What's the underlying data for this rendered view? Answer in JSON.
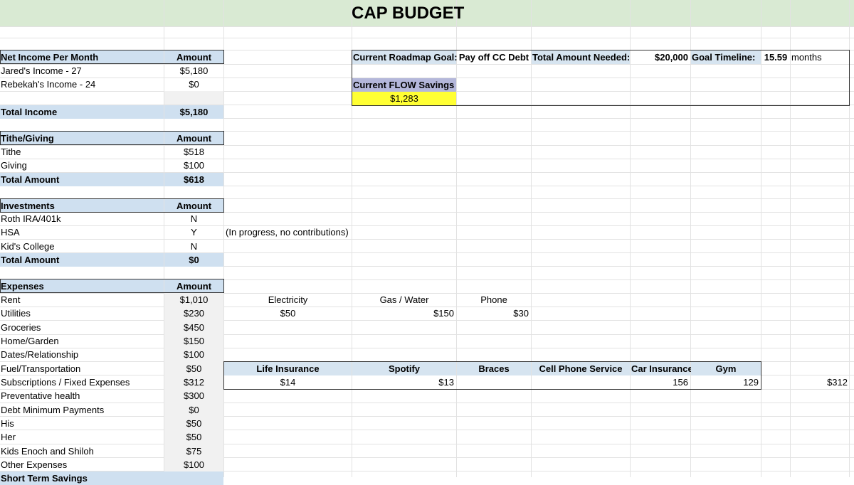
{
  "title": "CAP BUDGET",
  "income": {
    "header": "Net Income Per Month",
    "amount_header": "Amount",
    "rows": [
      {
        "label": "Jared's Income - 27",
        "value": "$5,180"
      },
      {
        "label": "Rebekah's Income - 24",
        "value": "$0"
      }
    ],
    "total_label": "Total Income",
    "total_value": "$5,180"
  },
  "tithe": {
    "header": "Tithe/Giving",
    "amount_header": "Amount",
    "rows": [
      {
        "label": "Tithe",
        "value": "$518"
      },
      {
        "label": "Giving",
        "value": "$100"
      }
    ],
    "total_label": "Total Amount",
    "total_value": "$618"
  },
  "investments": {
    "header": "Investments",
    "amount_header": "Amount",
    "rows": [
      {
        "label": "Roth IRA/401k",
        "value": "N"
      },
      {
        "label": "HSA",
        "value": "Y"
      },
      {
        "label": "Kid's College",
        "value": "N"
      }
    ],
    "hsa_note": "(In progress, no contributions)",
    "total_label": "Total Amount",
    "total_value": "$0"
  },
  "expenses": {
    "header": "Expenses",
    "amount_header": "Amount",
    "rows": [
      {
        "label": "Rent",
        "value": "$1,010"
      },
      {
        "label": "Utilities",
        "value": "$230"
      },
      {
        "label": "Groceries",
        "value": "$450"
      },
      {
        "label": "Home/Garden",
        "value": "$150"
      },
      {
        "label": "Dates/Relationship",
        "value": "$100"
      },
      {
        "label": "Fuel/Transportation",
        "value": "$50"
      },
      {
        "label": "Subscriptions / Fixed Expenses",
        "value": "$312"
      },
      {
        "label": "Preventative health",
        "value": "$300"
      },
      {
        "label": "Debt Minimum Payments",
        "value": "$0"
      },
      {
        "label": "His",
        "value": "$50"
      },
      {
        "label": "Her",
        "value": "$50"
      },
      {
        "label": "Kids  Enoch and Shiloh",
        "value": "$75"
      },
      {
        "label": "Other Expenses",
        "value": "$100"
      }
    ],
    "next_row_partial": "Short Term Savings"
  },
  "roadmap": {
    "goal_label": "Current Roadmap Goal:",
    "goal_value": "Pay off CC Debt",
    "needed_label": "Total Amount Needed:",
    "needed_value": "$20,000",
    "timeline_label": "Goal Timeline:",
    "timeline_value": "15.59",
    "timeline_unit": "months",
    "flow_label": "Current FLOW Savings",
    "flow_value": "$1,283"
  },
  "utilities": {
    "electricity_label": "Electricity",
    "electricity_value": "$50",
    "gas_label": "Gas / Water",
    "gas_value": "$150",
    "phone_label": "Phone",
    "phone_value": "$30"
  },
  "subscriptions": {
    "headers": [
      "Life Insurance",
      "Spotify",
      "Braces",
      "Cell Phone Service",
      "Car Insurance",
      "Gym"
    ],
    "values": [
      "$14",
      "$13",
      "",
      "",
      "156",
      "129"
    ],
    "total": "$312"
  }
}
